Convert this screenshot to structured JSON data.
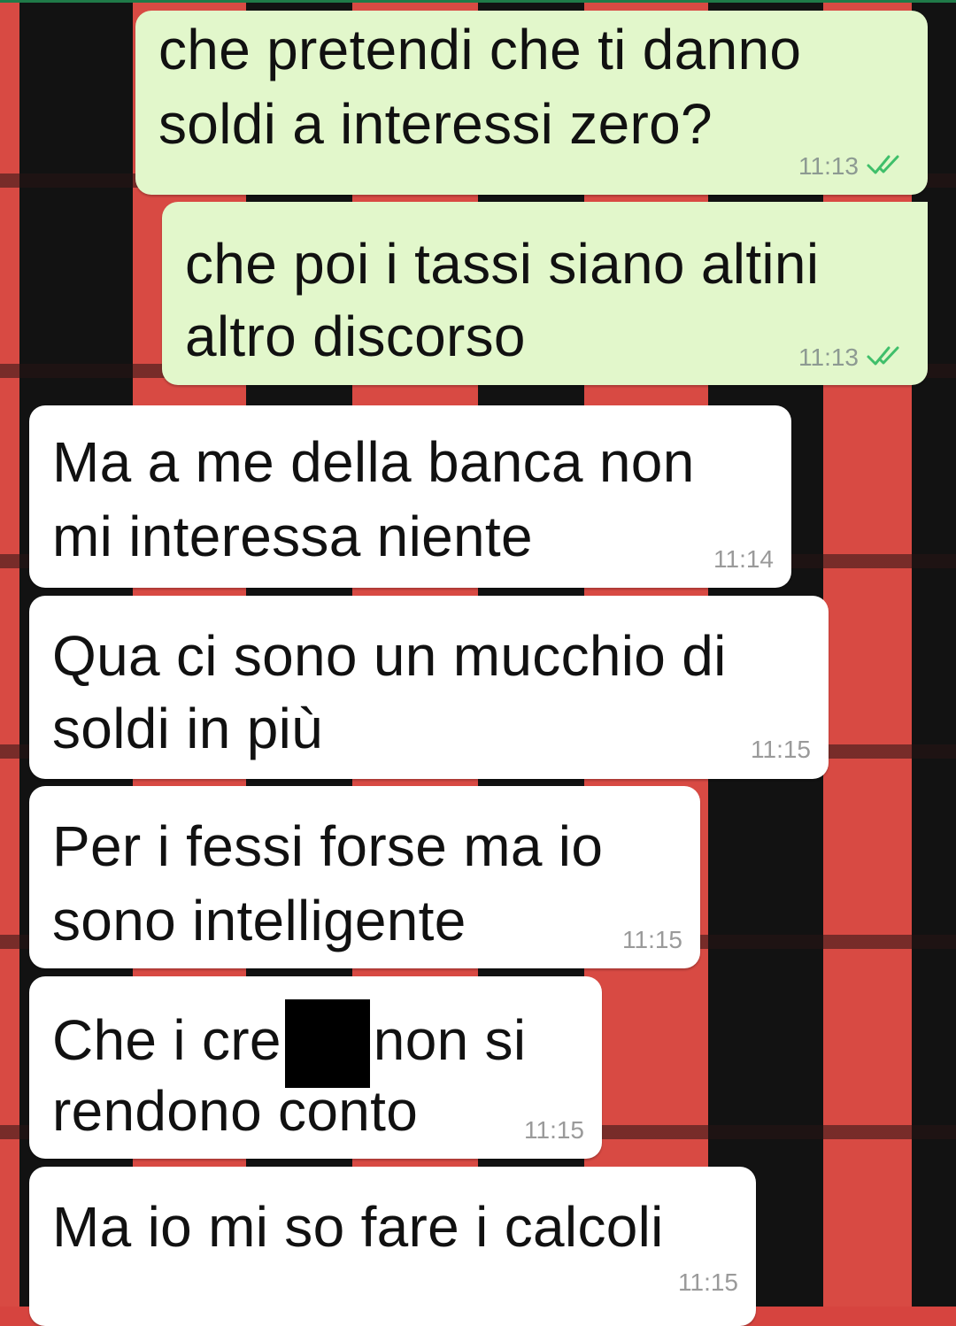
{
  "chat": {
    "messages": [
      {
        "direction": "outgoing",
        "lines": [
          "che pretendi che ti danno",
          "soldi a interessi zero?"
        ],
        "time": "11:13",
        "status_icon": "double-check-icon"
      },
      {
        "direction": "outgoing",
        "lines": [
          "che poi i tassi siano altini",
          "altro discorso"
        ],
        "time": "11:13",
        "status_icon": "double-check-icon"
      },
      {
        "direction": "incoming",
        "lines": [
          "Ma a me della banca non",
          "mi interessa niente"
        ],
        "time": "11:14"
      },
      {
        "direction": "incoming",
        "lines": [
          "Qua ci sono un mucchio di",
          "soldi in più"
        ],
        "time": "11:15"
      },
      {
        "direction": "incoming",
        "lines": [
          "Per i fessi forse ma io",
          "sono intelligente"
        ],
        "time": "11:15"
      },
      {
        "direction": "incoming",
        "lines_parts": {
          "before": "Che i cre",
          "after": "non si",
          "line2": "rendono conto"
        },
        "redacted": true,
        "time": "11:15"
      },
      {
        "direction": "incoming",
        "lines": [
          "Ma io mi so fare i calcoli"
        ],
        "time": "11:15"
      }
    ]
  },
  "colors": {
    "outgoing_bubble": "#e2f7cb",
    "incoming_bubble": "#ffffff",
    "read_ticks": "#34b7f1",
    "wallpaper_red": "#d84a43",
    "wallpaper_black": "#121212"
  }
}
